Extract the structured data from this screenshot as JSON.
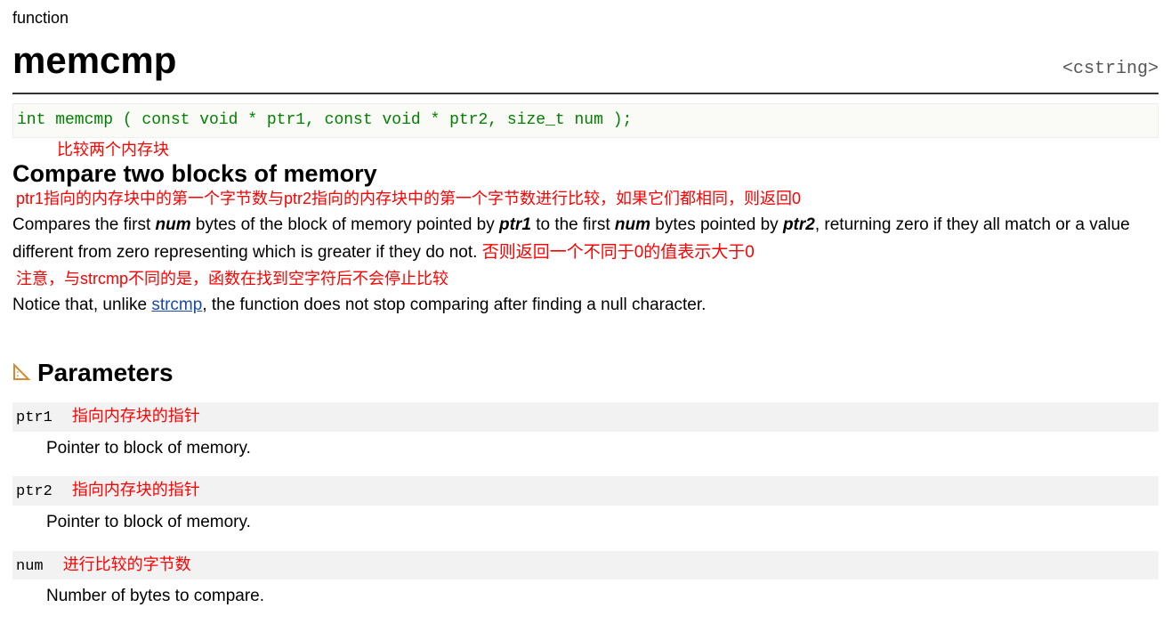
{
  "kind": "function",
  "title": "memcmp",
  "header_include": "<cstring>",
  "signature": "int memcmp ( const void * ptr1, const void * ptr2, size_t num );",
  "ann_compare_two": "比较两个内存块",
  "subtitle": "Compare two blocks of memory",
  "ann_ptr1_desc": "ptr1指向的内存块中的第一个字节数与ptr2指向的内存块中的第一个字节数进行比较，如果它们都相同，则返回0",
  "desc_seg1": "Compares the first ",
  "desc_num1": "num",
  "desc_seg2": " bytes of the block of memory pointed by ",
  "desc_ptr1": "ptr1",
  "desc_seg3": " to the first ",
  "desc_num2": "num",
  "desc_seg4": " bytes pointed by ",
  "desc_ptr2": "ptr2",
  "desc_seg5": ", returning zero if they all match or a value different from zero representing which is greater if they do not.  ",
  "ann_else_return": "否则返回一个不同于0的值表示大于0",
  "ann_notice": "注意，与strcmp不同的是，函数在找到空字符后不会停止比较",
  "notice_seg1": "Notice that, unlike ",
  "notice_link_text": "strcmp",
  "notice_seg2": ", the function does not stop comparing after finding a null character.",
  "section_params": "Parameters",
  "params": {
    "p1_name": "ptr1",
    "p1_ann": "指向内存块的指针",
    "p1_desc": "Pointer to block of memory.",
    "p2_name": "ptr2",
    "p2_ann": "指向内存块的指针",
    "p2_desc": "Pointer to block of memory.",
    "p3_name": "num",
    "p3_ann": "进行比较的字节数",
    "p3_desc": "Number of bytes to compare."
  }
}
